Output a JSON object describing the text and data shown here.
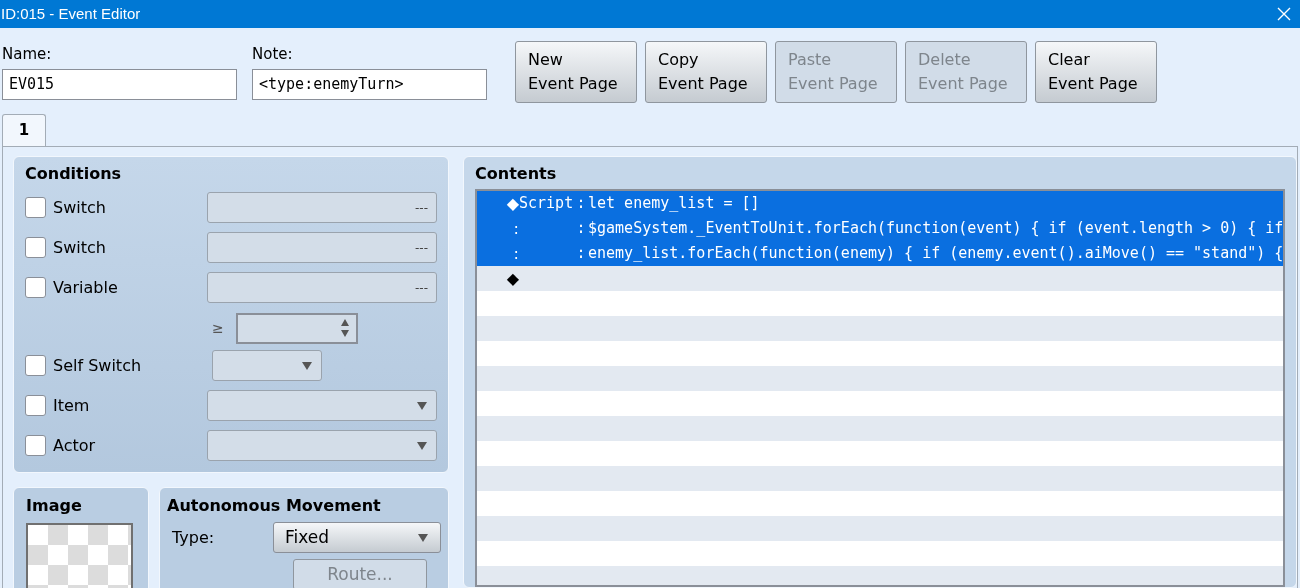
{
  "window": {
    "title": "ID:015 - Event Editor"
  },
  "name_field": {
    "label": "Name:",
    "value": "EV015"
  },
  "note_field": {
    "label": "Note:",
    "value": "<type:enemyTurn>"
  },
  "page_buttons": [
    {
      "line1": "New",
      "line2": "Event Page",
      "disabled": false
    },
    {
      "line1": "Copy",
      "line2": "Event Page",
      "disabled": false
    },
    {
      "line1": "Paste",
      "line2": "Event Page",
      "disabled": true
    },
    {
      "line1": "Delete",
      "line2": "Event Page",
      "disabled": true
    },
    {
      "line1": "Clear",
      "line2": "Event Page",
      "disabled": false
    }
  ],
  "tabs": [
    {
      "label": "1",
      "selected": true
    }
  ],
  "conditions": {
    "title": "Conditions",
    "items": [
      {
        "kind": "picker",
        "label": "Switch",
        "checked": false,
        "button": "---"
      },
      {
        "kind": "picker",
        "label": "Switch",
        "checked": false,
        "button": "---"
      },
      {
        "kind": "variable",
        "label": "Variable",
        "checked": false,
        "button": "---",
        "operator": "≥"
      },
      {
        "kind": "small_select",
        "label": "Self Switch",
        "checked": false
      },
      {
        "kind": "select",
        "label": "Item",
        "checked": false
      },
      {
        "kind": "select",
        "label": "Actor",
        "checked": false
      }
    ]
  },
  "image": {
    "title": "Image"
  },
  "autonomous_movement": {
    "title": "Autonomous Movement",
    "type_label": "Type:",
    "type_value": "Fixed",
    "route_button": {
      "label": "Route...",
      "disabled": true
    }
  },
  "contents": {
    "title": "Contents",
    "rows": [
      {
        "marker": "◆",
        "command": "Script",
        "separator": ":",
        "text": "let enemy_list = []",
        "selected": true
      },
      {
        "marker": ":",
        "separator": ":",
        "text": "$gameSystem._EventToUnit.forEach(function(event) { if (event.length > 0) { if",
        "selected": true
      },
      {
        "marker": ":",
        "separator": ":",
        "text": "enemy_list.forEach(function(enemy) { if (enemy.event().aiMove() == \"stand\") {",
        "selected": true
      },
      {
        "marker": "◆",
        "selected": false
      }
    ]
  }
}
